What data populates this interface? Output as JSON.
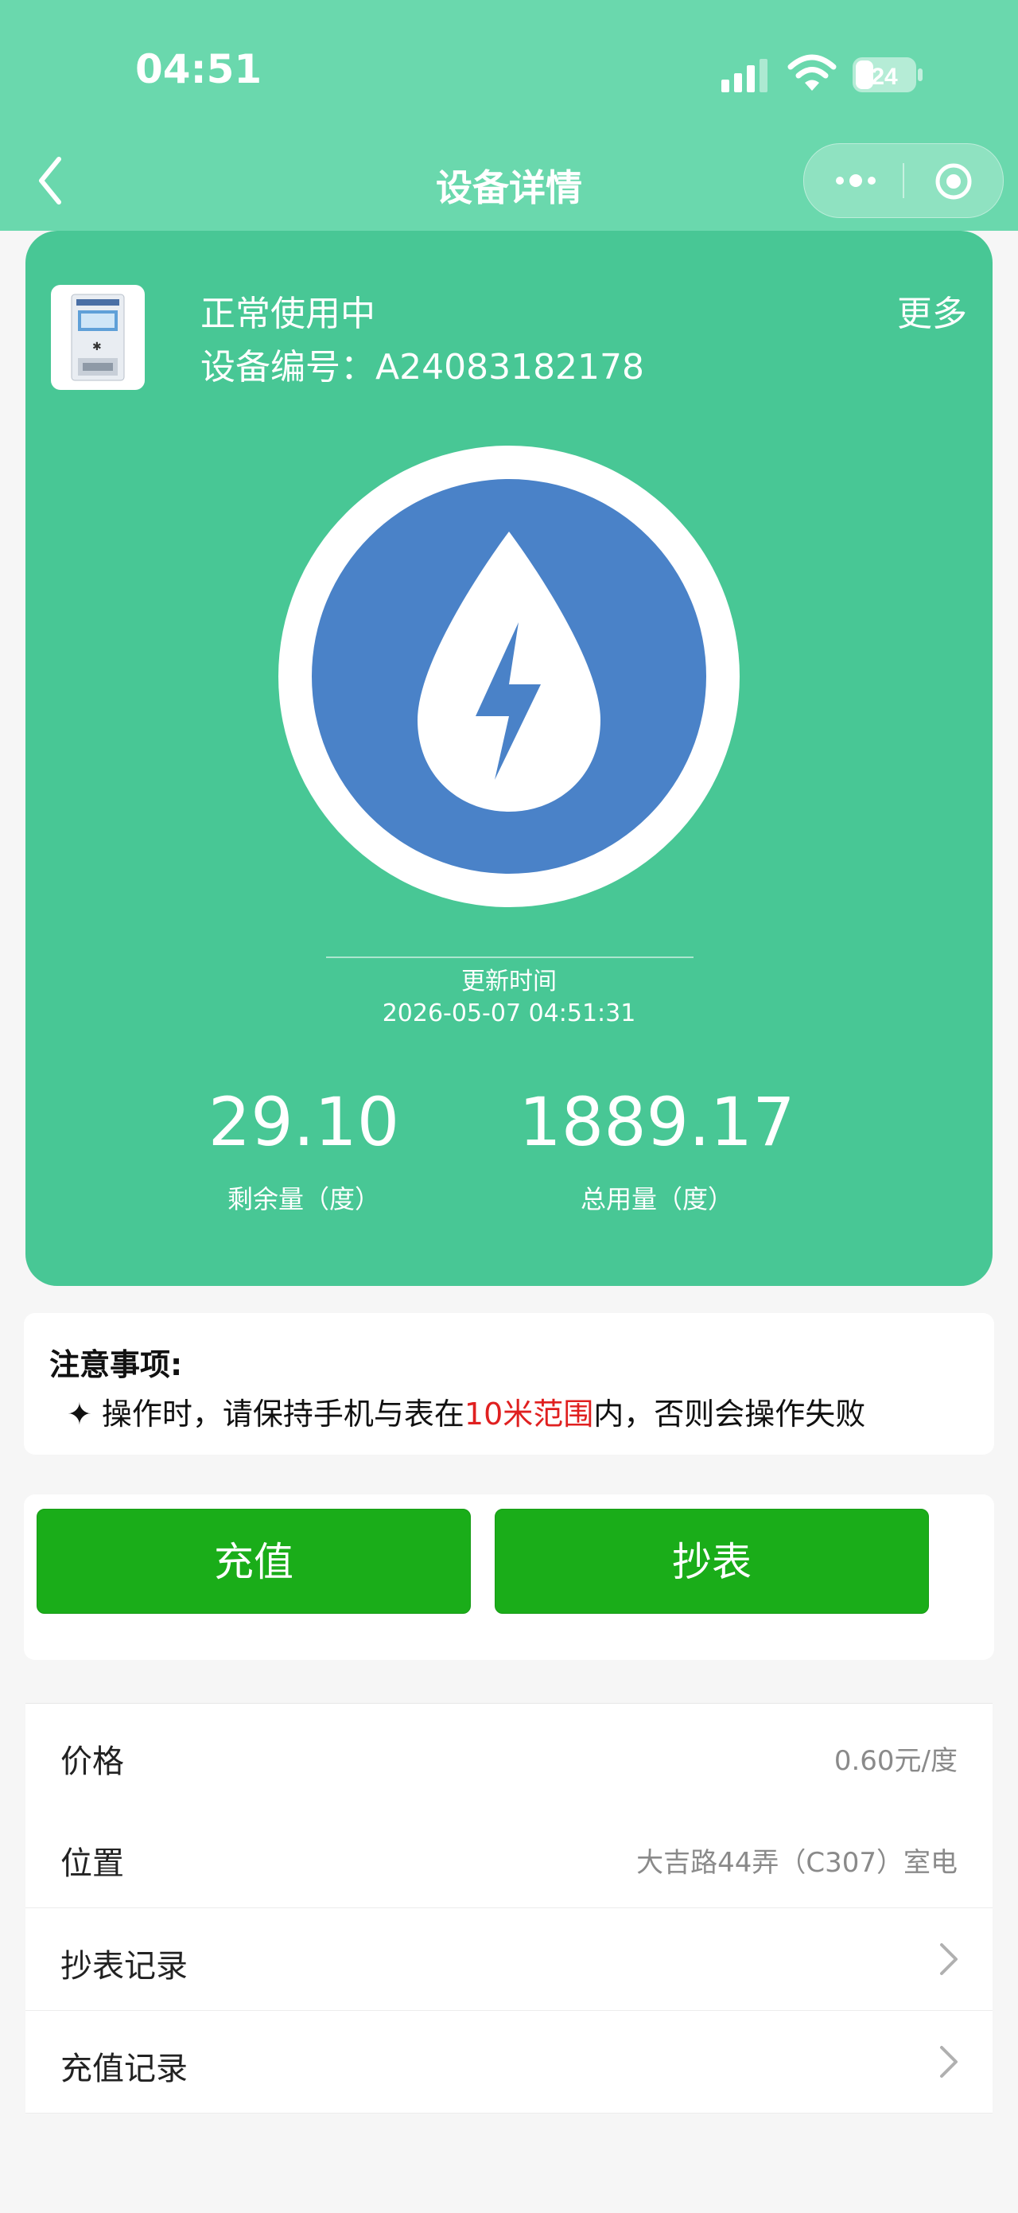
{
  "status_bar": {
    "time": "04:51",
    "battery": "24",
    "icons": [
      "signal-icon",
      "wifi-icon",
      "battery-icon"
    ]
  },
  "nav": {
    "title": "设备详情",
    "back_icon": "chevron-left-icon",
    "more_icon": "more-dots-icon",
    "close_icon": "target-close-icon"
  },
  "device": {
    "status": "正常使用中",
    "number_label": "设备编号：",
    "number": "A24083182178",
    "more_label": "更多",
    "update_label": "更新时间",
    "update_time": "2026-05-07 04:51:31",
    "remaining_value": "29.10",
    "remaining_label": "剩余量（度）",
    "total_value": "1889.17",
    "total_label": "总用量（度）"
  },
  "notice": {
    "title": "注意事项:",
    "prefix": "✦ 操作时，请保持手机与表在",
    "highlight": "10米范围",
    "suffix": "内，否则会操作失败"
  },
  "actions": {
    "recharge": "充值",
    "read_meter": "抄表"
  },
  "info": {
    "price_label": "价格",
    "price_value": "0.60元/度",
    "location_label": "位置",
    "location_value": "大吉路44弄（C307）室电",
    "read_records": "抄表记录",
    "recharge_records": "充值记录"
  },
  "colors": {
    "header": "#6ad8ad",
    "card": "#48c795",
    "button": "#1aad19",
    "logo_blue": "#4a82c8",
    "highlight_red": "#e02020"
  }
}
